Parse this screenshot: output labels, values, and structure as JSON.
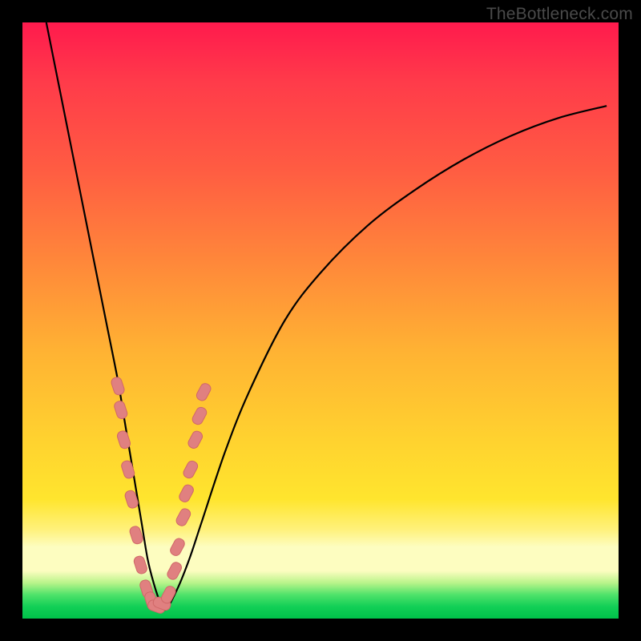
{
  "watermark": "TheBottleneck.com",
  "colors": {
    "frame": "#000000",
    "curve": "#000000",
    "marker_fill": "#e08080",
    "marker_stroke": "#d06868",
    "gradient_top": "#ff1a4d",
    "gradient_bottom": "#00c24a"
  },
  "chart_data": {
    "type": "line",
    "title": "",
    "xlabel": "",
    "ylabel": "",
    "xlim": [
      0,
      100
    ],
    "ylim": [
      0,
      100
    ],
    "grid": false,
    "legend": false,
    "series": [
      {
        "name": "bottleneck-curve",
        "x": [
          4,
          6,
          8,
          10,
          12,
          14,
          16,
          17,
          18,
          19,
          20,
          21,
          22,
          23,
          24,
          26,
          28,
          30,
          34,
          38,
          44,
          50,
          58,
          66,
          74,
          82,
          90,
          98
        ],
        "y": [
          100,
          90,
          80,
          70,
          60,
          50,
          40,
          34,
          28,
          22,
          16,
          10,
          6,
          3,
          1.5,
          5,
          10,
          16,
          28,
          38,
          50,
          58,
          66,
          72,
          77,
          81,
          84,
          86
        ]
      }
    ],
    "markers": [
      {
        "x": 16.0,
        "y": 39
      },
      {
        "x": 16.5,
        "y": 35
      },
      {
        "x": 17.0,
        "y": 30
      },
      {
        "x": 17.7,
        "y": 25
      },
      {
        "x": 18.3,
        "y": 20
      },
      {
        "x": 19.1,
        "y": 14
      },
      {
        "x": 19.8,
        "y": 9
      },
      {
        "x": 20.8,
        "y": 5
      },
      {
        "x": 21.6,
        "y": 3
      },
      {
        "x": 22.5,
        "y": 2
      },
      {
        "x": 23.4,
        "y": 2.5
      },
      {
        "x": 24.5,
        "y": 4
      },
      {
        "x": 25.5,
        "y": 8
      },
      {
        "x": 26.0,
        "y": 12
      },
      {
        "x": 27.0,
        "y": 17
      },
      {
        "x": 27.5,
        "y": 21
      },
      {
        "x": 28.2,
        "y": 25
      },
      {
        "x": 29.0,
        "y": 30
      },
      {
        "x": 29.7,
        "y": 34
      },
      {
        "x": 30.4,
        "y": 38
      }
    ]
  }
}
